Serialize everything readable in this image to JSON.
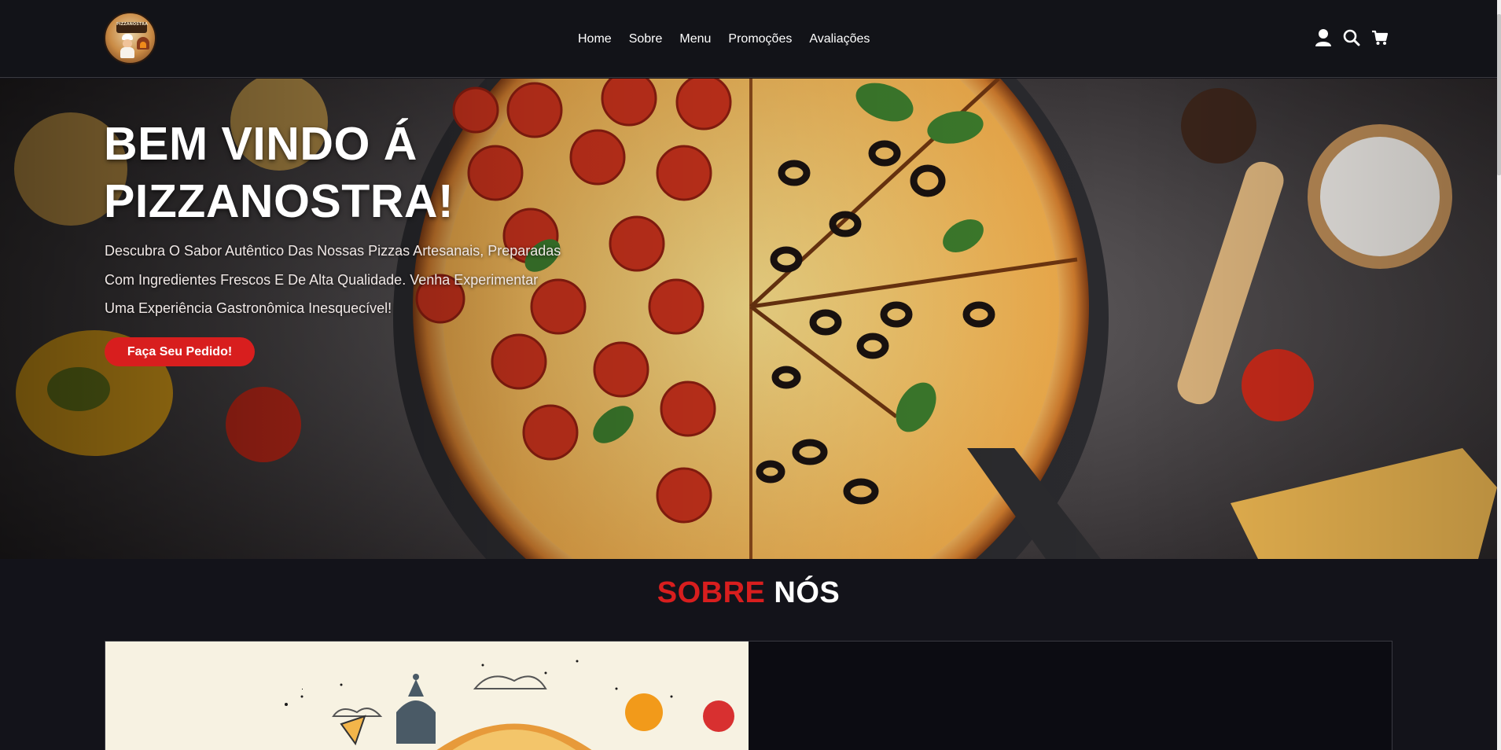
{
  "header": {
    "logo_text": "PIZZANOSTRA",
    "nav": [
      "Home",
      "Sobre",
      "Menu",
      "Promoções",
      "Avaliações"
    ],
    "icons": [
      "user-icon",
      "search-icon",
      "cart-icon"
    ]
  },
  "hero": {
    "title": "BEM VINDO Á PIZZANOSTRA!",
    "description": "Descubra O Sabor Autêntico Das Nossas Pizzas Artesanais, Preparadas Com Ingredientes Frescos E De Alta Qualidade. Venha Experimentar Uma Experiência Gastronômica Inesquecível!",
    "cta": "Faça Seu Pedido!"
  },
  "about": {
    "title_red": "SOBRE",
    "title_white": "NÓS"
  },
  "colors": {
    "accent": "#d81e1e",
    "header_bg": "#121318",
    "page_bg": "#13131a"
  }
}
